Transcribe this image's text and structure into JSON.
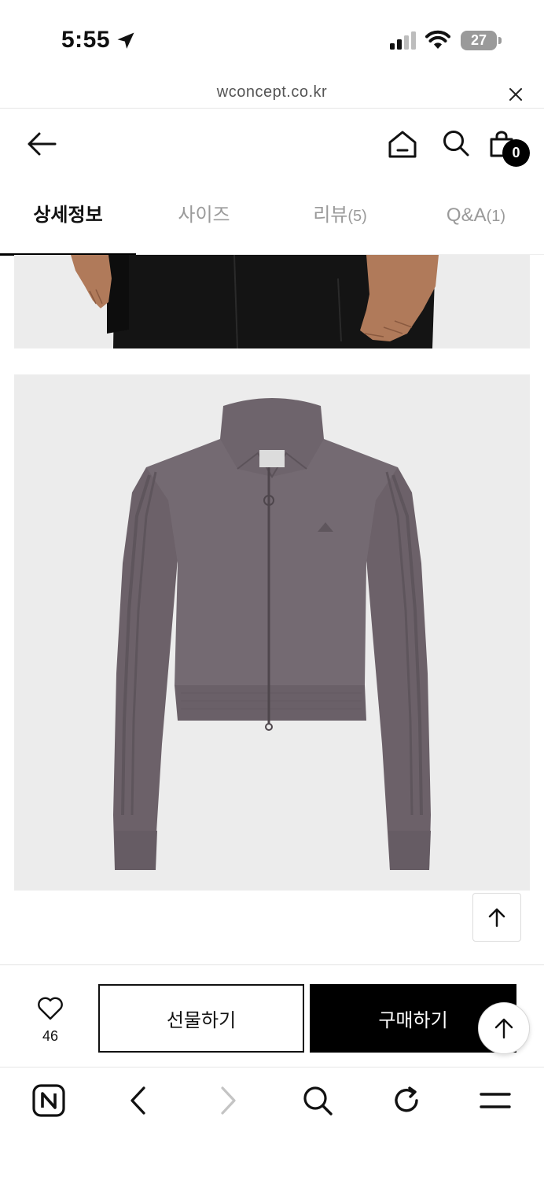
{
  "status_bar": {
    "time": "5:55",
    "battery_level": "27",
    "icons": [
      "location-arrow-icon",
      "cellular-signal-icon",
      "wifi-icon",
      "battery-icon"
    ]
  },
  "browser": {
    "url": "wconcept.co.kr",
    "close_icon": "close-icon"
  },
  "header": {
    "icons": [
      "back-arrow-icon",
      "home-icon",
      "search-icon",
      "shopping-bag-icon"
    ],
    "cart_count": "0"
  },
  "tabs": [
    {
      "label": "상세정보",
      "count": "",
      "active": true
    },
    {
      "label": "사이즈",
      "count": "",
      "active": false
    },
    {
      "label": "리뷰",
      "count": "(5)",
      "active": false
    },
    {
      "label": "Q&A",
      "count": "(1)",
      "active": false
    }
  ],
  "product_images": [
    "black-pants-photo",
    "grey-track-jacket-photo"
  ],
  "actions": {
    "like_count": "46",
    "gift_label": "선물하기",
    "buy_label": "구매하기"
  },
  "browser_nav": {
    "icons": [
      "naver-logo-icon",
      "back-chevron-icon",
      "forward-chevron-icon",
      "search-icon",
      "refresh-icon",
      "menu-icon"
    ]
  },
  "colors": {
    "accent": "#000000",
    "image_background": "#ececec",
    "jacket": "#6e646c"
  }
}
